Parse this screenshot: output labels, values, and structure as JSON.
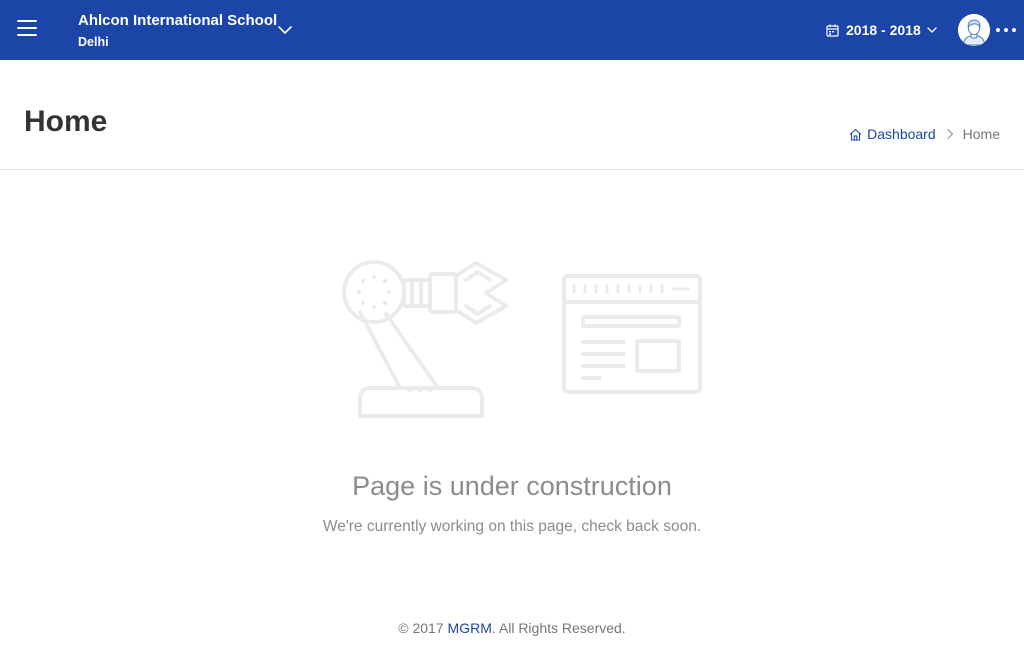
{
  "header": {
    "school_name": "Ahlcon International School",
    "school_city": "Delhi",
    "academic_year": "2018 - 2018",
    "brand_color": "#1b46a8"
  },
  "page": {
    "title": "Home",
    "breadcrumb": {
      "root": "Dashboard",
      "current": "Home"
    }
  },
  "construction": {
    "title": "Page is under construction",
    "subtitle": "We're currently working on this page, check back soon."
  },
  "footer": {
    "prefix": "© 2017 ",
    "brand": "MGRM",
    "suffix": ". All Rights Reserved."
  },
  "icons": {
    "menu": "hamburger-menu-icon",
    "toggle": "chevron-down-icon",
    "calendar": "calendar-icon",
    "avatar": "user-avatar-icon",
    "more": "more-dots-icon",
    "home": "home-icon",
    "separator": "chevron-right-icon",
    "robot_arm": "robot-arm-icon",
    "browser": "browser-window-icon"
  }
}
